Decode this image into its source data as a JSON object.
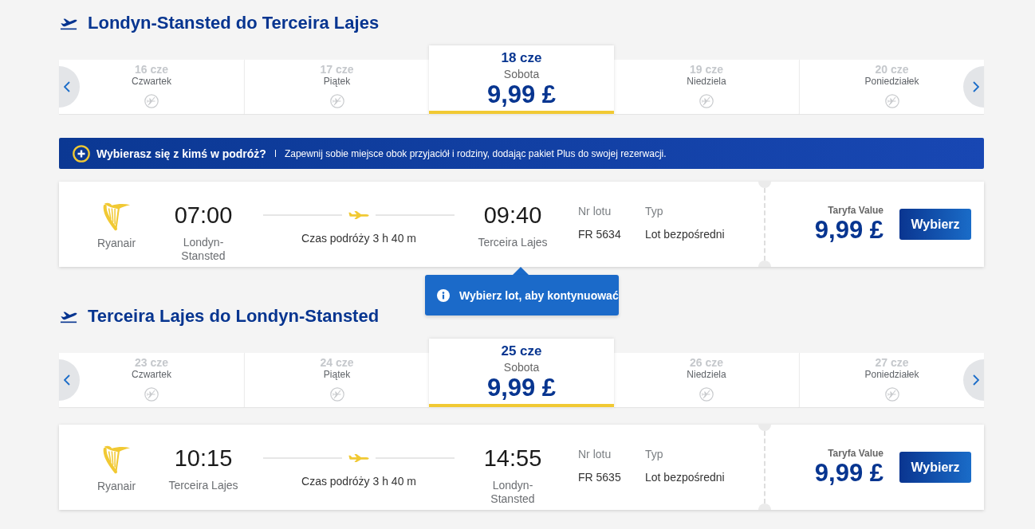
{
  "journeys": [
    {
      "title": "Londyn-Stansted do Terceira Lajes",
      "dates": [
        {
          "date": "16 cze",
          "weekday": "Czwartek",
          "kind": "no_flights",
          "selected": false
        },
        {
          "date": "17 cze",
          "weekday": "Piątek",
          "kind": "no_flights",
          "selected": false
        },
        {
          "date": "18 cze",
          "weekday": "Sobota",
          "kind": "fare",
          "price": "9,99 £",
          "selected": true
        },
        {
          "date": "19 cze",
          "weekday": "Niedziela",
          "kind": "no_flights",
          "selected": false
        },
        {
          "date": "20 cze",
          "weekday": "Poniedziałek",
          "kind": "no_flights",
          "selected": false
        }
      ],
      "banner": {
        "title": "Wybierasz się z kimś w podróż?",
        "text": "Zapewnij sobie miejsce obok przyjaciół i rodziny, dodając pakiet Plus do swojej rezerwacji."
      },
      "flight": {
        "airline": "Ryanair",
        "departure_time": "07:00",
        "departure_airport": "Londyn-Stansted",
        "duration": "Czas podróży 3 h 40 m",
        "arrival_time": "09:40",
        "arrival_airport": "Terceira Lajes",
        "flight_number_label": "Nr lotu",
        "flight_number": "FR 5634",
        "type_label": "Typ",
        "type": "Lot bezpośredni",
        "fare_label": "Taryfa Value",
        "price": "9,99 £",
        "button": "Wybierz"
      },
      "tooltip": {
        "text": "Wybierz lot, aby kontynuować"
      }
    },
    {
      "title": "Terceira Lajes do Londyn-Stansted",
      "dates": [
        {
          "date": "23 cze",
          "weekday": "Czwartek",
          "kind": "no_flights",
          "selected": false
        },
        {
          "date": "24 cze",
          "weekday": "Piątek",
          "kind": "no_flights",
          "selected": false
        },
        {
          "date": "25 cze",
          "weekday": "Sobota",
          "kind": "fare",
          "price": "9,99 £",
          "selected": true
        },
        {
          "date": "26 cze",
          "weekday": "Niedziela",
          "kind": "no_flights",
          "selected": false
        },
        {
          "date": "27 cze",
          "weekday": "Poniedziałek",
          "kind": "no_flights",
          "selected": false
        }
      ],
      "flight": {
        "airline": "Ryanair",
        "departure_time": "10:15",
        "departure_airport": "Terceira Lajes",
        "duration": "Czas podróży 3 h 40 m",
        "arrival_time": "14:55",
        "arrival_airport": "Londyn-Stansted",
        "flight_number_label": "Nr lotu",
        "flight_number": "FR 5635",
        "type_label": "Typ",
        "type": "Lot bezpośredni",
        "fare_label": "Taryfa Value",
        "price": "9,99 £",
        "button": "Wybierz"
      }
    }
  ]
}
